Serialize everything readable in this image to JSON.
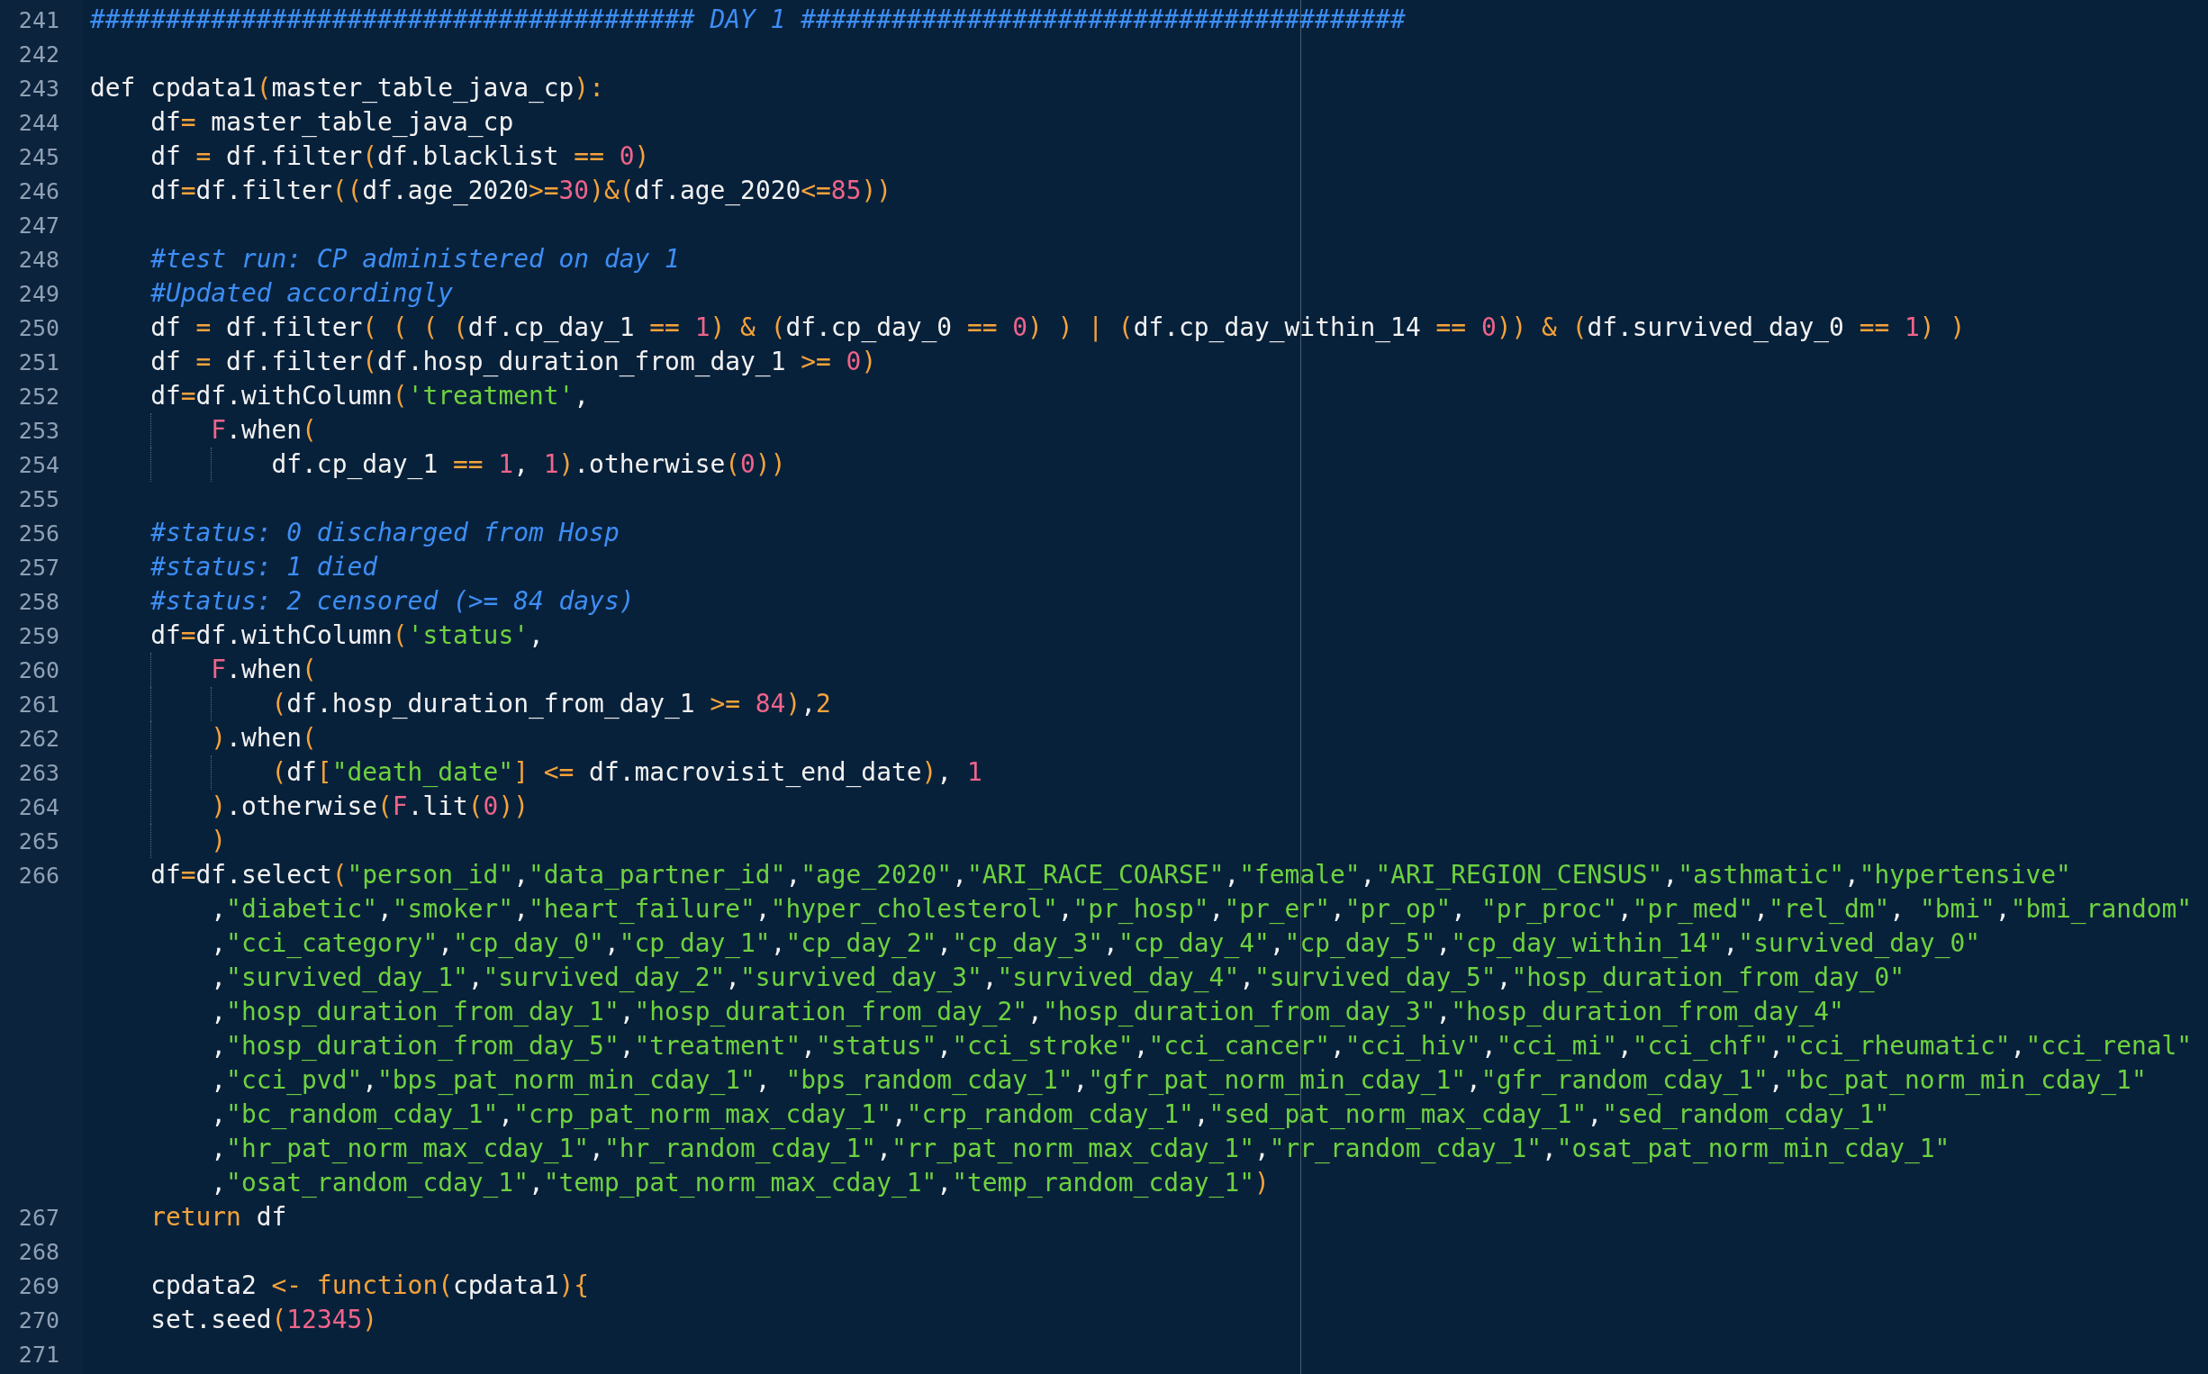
{
  "editor": {
    "lines": [
      {
        "number": "241",
        "rows": [
          {
            "tokens": [
              {
                "kind": "comment",
                "text": "######################################## DAY 1 ########################################"
              }
            ]
          }
        ]
      },
      {
        "number": "242"
      },
      {
        "number": "243",
        "rows": [
          {
            "tokens": [
              {
                "kind": "plain",
                "text": "def cpdata1"
              },
              {
                "kind": "op",
                "text": "("
              },
              {
                "kind": "plain",
                "text": "master_table_java_cp"
              },
              {
                "kind": "op",
                "text": "):"
              }
            ]
          }
        ]
      },
      {
        "number": "244",
        "rows": [
          {
            "tokens": [
              {
                "kind": "indent"
              },
              {
                "kind": "plain",
                "text": "df"
              },
              {
                "kind": "op",
                "text": "="
              },
              {
                "kind": "plain",
                "text": " master_table_java_cp"
              }
            ]
          }
        ]
      },
      {
        "number": "245",
        "rows": [
          {
            "tokens": [
              {
                "kind": "indent"
              },
              {
                "kind": "plain",
                "text": "df "
              },
              {
                "kind": "op",
                "text": "="
              },
              {
                "kind": "plain",
                "text": " df.filter"
              },
              {
                "kind": "op",
                "text": "("
              },
              {
                "kind": "plain",
                "text": "df.blacklist "
              },
              {
                "kind": "op",
                "text": "== "
              },
              {
                "kind": "num",
                "text": "0"
              },
              {
                "kind": "op",
                "text": ")"
              }
            ]
          }
        ]
      },
      {
        "number": "246",
        "rows": [
          {
            "tokens": [
              {
                "kind": "indent"
              },
              {
                "kind": "plain",
                "text": "df"
              },
              {
                "kind": "op",
                "text": "="
              },
              {
                "kind": "plain",
                "text": "df.filter"
              },
              {
                "kind": "op",
                "text": "(("
              },
              {
                "kind": "plain",
                "text": "df.age_2020"
              },
              {
                "kind": "op",
                "text": ">="
              },
              {
                "kind": "num",
                "text": "30"
              },
              {
                "kind": "op",
                "text": ")&("
              },
              {
                "kind": "plain",
                "text": "df.age_2020"
              },
              {
                "kind": "op",
                "text": "<="
              },
              {
                "kind": "num",
                "text": "85"
              },
              {
                "kind": "op",
                "text": "))"
              }
            ]
          }
        ]
      },
      {
        "number": "247"
      },
      {
        "number": "248",
        "rows": [
          {
            "tokens": [
              {
                "kind": "indent"
              },
              {
                "kind": "comment",
                "text": "#test run: CP administered on day 1"
              }
            ]
          }
        ]
      },
      {
        "number": "249",
        "rows": [
          {
            "tokens": [
              {
                "kind": "indent"
              },
              {
                "kind": "comment",
                "text": "#Updated accordingly"
              }
            ]
          }
        ]
      },
      {
        "number": "250",
        "rows": [
          {
            "tokens": [
              {
                "kind": "indent"
              },
              {
                "kind": "plain",
                "text": "df "
              },
              {
                "kind": "op",
                "text": "="
              },
              {
                "kind": "plain",
                "text": " df.filter"
              },
              {
                "kind": "op",
                "text": "( ( ( ("
              },
              {
                "kind": "plain",
                "text": "df.cp_day_1 "
              },
              {
                "kind": "op",
                "text": "== "
              },
              {
                "kind": "num",
                "text": "1"
              },
              {
                "kind": "op",
                "text": ") & ("
              },
              {
                "kind": "plain",
                "text": "df.cp_day_0 "
              },
              {
                "kind": "op",
                "text": "== "
              },
              {
                "kind": "num",
                "text": "0"
              },
              {
                "kind": "op",
                "text": ") ) | ("
              },
              {
                "kind": "plain",
                "text": "df.cp_day_within_14 "
              },
              {
                "kind": "op",
                "text": "== "
              },
              {
                "kind": "num",
                "text": "0"
              },
              {
                "kind": "op",
                "text": ")) & ("
              },
              {
                "kind": "plain",
                "text": "df.survived_day_0 "
              },
              {
                "kind": "op",
                "text": "== "
              },
              {
                "kind": "num",
                "text": "1"
              },
              {
                "kind": "op",
                "text": ") )"
              }
            ]
          }
        ]
      },
      {
        "number": "251",
        "rows": [
          {
            "tokens": [
              {
                "kind": "indent"
              },
              {
                "kind": "plain",
                "text": "df "
              },
              {
                "kind": "op",
                "text": "="
              },
              {
                "kind": "plain",
                "text": " df.filter"
              },
              {
                "kind": "op",
                "text": "("
              },
              {
                "kind": "plain",
                "text": "df.hosp_duration_from_day_1 "
              },
              {
                "kind": "op",
                "text": ">= "
              },
              {
                "kind": "num",
                "text": "0"
              },
              {
                "kind": "op",
                "text": ")"
              }
            ]
          }
        ]
      },
      {
        "number": "252",
        "rows": [
          {
            "tokens": [
              {
                "kind": "indent"
              },
              {
                "kind": "plain",
                "text": "df"
              },
              {
                "kind": "op",
                "text": "="
              },
              {
                "kind": "plain",
                "text": "df.withColumn"
              },
              {
                "kind": "op",
                "text": "("
              },
              {
                "kind": "str",
                "text": "'treatment'"
              },
              {
                "kind": "plain",
                "text": ","
              }
            ]
          }
        ]
      },
      {
        "number": "253",
        "rows": [
          {
            "tokens": [
              {
                "kind": "indent"
              },
              {
                "kind": "guide"
              },
              {
                "kind": "builtin",
                "text": "F"
              },
              {
                "kind": "plain",
                "text": ".when"
              },
              {
                "kind": "op",
                "text": "("
              }
            ]
          }
        ]
      },
      {
        "number": "254",
        "rows": [
          {
            "tokens": [
              {
                "kind": "indent"
              },
              {
                "kind": "guide"
              },
              {
                "kind": "guide"
              },
              {
                "kind": "plain",
                "text": "df.cp_day_1 "
              },
              {
                "kind": "op",
                "text": "== "
              },
              {
                "kind": "num",
                "text": "1"
              },
              {
                "kind": "plain",
                "text": ", "
              },
              {
                "kind": "num",
                "text": "1"
              },
              {
                "kind": "op",
                "text": ")"
              },
              {
                "kind": "plain",
                "text": ".otherwise"
              },
              {
                "kind": "op",
                "text": "("
              },
              {
                "kind": "num",
                "text": "0"
              },
              {
                "kind": "op",
                "text": "))"
              }
            ]
          }
        ]
      },
      {
        "number": "255"
      },
      {
        "number": "256",
        "rows": [
          {
            "tokens": [
              {
                "kind": "indent"
              },
              {
                "kind": "comment",
                "text": "#status: 0 discharged from Hosp"
              }
            ]
          }
        ]
      },
      {
        "number": "257",
        "rows": [
          {
            "tokens": [
              {
                "kind": "indent"
              },
              {
                "kind": "comment",
                "text": "#status: 1 died"
              }
            ]
          }
        ]
      },
      {
        "number": "258",
        "rows": [
          {
            "tokens": [
              {
                "kind": "indent"
              },
              {
                "kind": "comment",
                "text": "#status: 2 censored (>= 84 days)"
              }
            ]
          }
        ]
      },
      {
        "number": "259",
        "rows": [
          {
            "tokens": [
              {
                "kind": "indent"
              },
              {
                "kind": "plain",
                "text": "df"
              },
              {
                "kind": "op",
                "text": "="
              },
              {
                "kind": "plain",
                "text": "df.withColumn"
              },
              {
                "kind": "op",
                "text": "("
              },
              {
                "kind": "str",
                "text": "'status'"
              },
              {
                "kind": "plain",
                "text": ","
              }
            ]
          }
        ]
      },
      {
        "number": "260",
        "rows": [
          {
            "tokens": [
              {
                "kind": "indent"
              },
              {
                "kind": "guide"
              },
              {
                "kind": "builtin",
                "text": "F"
              },
              {
                "kind": "plain",
                "text": ".when"
              },
              {
                "kind": "op",
                "text": "("
              }
            ]
          }
        ]
      },
      {
        "number": "261",
        "rows": [
          {
            "tokens": [
              {
                "kind": "indent"
              },
              {
                "kind": "guide"
              },
              {
                "kind": "guide"
              },
              {
                "kind": "op",
                "text": "("
              },
              {
                "kind": "plain",
                "text": "df.hosp_duration_from_day_1 "
              },
              {
                "kind": "op",
                "text": ">= "
              },
              {
                "kind": "num",
                "text": "84"
              },
              {
                "kind": "op",
                "text": ")"
              },
              {
                "kind": "plain",
                "text": ","
              },
              {
                "kind": "op",
                "text": "2"
              }
            ]
          }
        ]
      },
      {
        "number": "262",
        "rows": [
          {
            "tokens": [
              {
                "kind": "indent"
              },
              {
                "kind": "guide"
              },
              {
                "kind": "op",
                "text": ")"
              },
              {
                "kind": "plain",
                "text": ".when"
              },
              {
                "kind": "op",
                "text": "("
              }
            ]
          }
        ]
      },
      {
        "number": "263",
        "rows": [
          {
            "tokens": [
              {
                "kind": "indent"
              },
              {
                "kind": "guide"
              },
              {
                "kind": "guide"
              },
              {
                "kind": "op",
                "text": "("
              },
              {
                "kind": "plain",
                "text": "df"
              },
              {
                "kind": "op",
                "text": "["
              },
              {
                "kind": "str",
                "text": "\"death_date\""
              },
              {
                "kind": "op",
                "text": "] <="
              },
              {
                "kind": "plain",
                "text": " df.macrovisit_end_date"
              },
              {
                "kind": "op",
                "text": ")"
              },
              {
                "kind": "plain",
                "text": ", "
              },
              {
                "kind": "num",
                "text": "1"
              }
            ]
          }
        ]
      },
      {
        "number": "264",
        "rows": [
          {
            "tokens": [
              {
                "kind": "indent"
              },
              {
                "kind": "guide"
              },
              {
                "kind": "op",
                "text": ")"
              },
              {
                "kind": "plain",
                "text": ".otherwise"
              },
              {
                "kind": "op",
                "text": "("
              },
              {
                "kind": "builtin",
                "text": "F"
              },
              {
                "kind": "plain",
                "text": ".lit"
              },
              {
                "kind": "op",
                "text": "("
              },
              {
                "kind": "num",
                "text": "0"
              },
              {
                "kind": "op",
                "text": "))"
              }
            ]
          }
        ]
      },
      {
        "number": "265",
        "rows": [
          {
            "tokens": [
              {
                "kind": "indent"
              },
              {
                "kind": "guide"
              },
              {
                "kind": "op",
                "text": ")"
              }
            ]
          }
        ]
      },
      {
        "number": "266",
        "rows": [
          {
            "tokens": [
              {
                "kind": "indent"
              },
              {
                "kind": "plain",
                "text": "df"
              },
              {
                "kind": "op",
                "text": "="
              },
              {
                "kind": "plain",
                "text": "df.select"
              },
              {
                "kind": "op",
                "text": "("
              },
              {
                "kind": "str",
                "text": "\"person_id\""
              },
              {
                "kind": "str",
                "lead": ",",
                "text": "\"data_partner_id\""
              },
              {
                "kind": "str",
                "lead": ",",
                "text": "\"age_2020\""
              },
              {
                "kind": "str",
                "lead": ",",
                "text": "\"ARI_RACE_COARSE\""
              },
              {
                "kind": "str",
                "lead": ",",
                "text": "\"female\""
              },
              {
                "kind": "str",
                "lead": ",",
                "text": "\"ARI_REGION_CENSUS\""
              },
              {
                "kind": "str",
                "lead": ",",
                "text": "\"asthmatic\""
              },
              {
                "kind": "str",
                "lead": ",",
                "text": "\"hypertensive\""
              }
            ]
          },
          {
            "tokens": [
              {
                "kind": "indent"
              },
              {
                "kind": "indent"
              },
              {
                "kind": "str",
                "lead": ",",
                "text": "\"diabetic\""
              },
              {
                "kind": "str",
                "lead": ",",
                "text": "\"smoker\""
              },
              {
                "kind": "str",
                "lead": ",",
                "text": "\"heart_failure\""
              },
              {
                "kind": "str",
                "lead": ",",
                "text": "\"hyper_cholesterol\""
              },
              {
                "kind": "str",
                "lead": ",",
                "text": "\"pr_hosp\""
              },
              {
                "kind": "str",
                "lead": ",",
                "text": "\"pr_er\""
              },
              {
                "kind": "str",
                "lead": ",",
                "text": "\"pr_op\""
              },
              {
                "kind": "str",
                "lead": ", ",
                "text": "\"pr_proc\""
              },
              {
                "kind": "str",
                "lead": ",",
                "text": "\"pr_med\""
              },
              {
                "kind": "str",
                "lead": ",",
                "text": "\"rel_dm\""
              },
              {
                "kind": "str",
                "lead": ", ",
                "text": "\"bmi\""
              },
              {
                "kind": "str",
                "lead": ",",
                "text": "\"bmi_random\""
              }
            ]
          },
          {
            "tokens": [
              {
                "kind": "indent"
              },
              {
                "kind": "indent"
              },
              {
                "kind": "str",
                "lead": ",",
                "text": "\"cci_category\""
              },
              {
                "kind": "str",
                "lead": ",",
                "text": "\"cp_day_0\""
              },
              {
                "kind": "str",
                "lead": ",",
                "text": "\"cp_day_1\""
              },
              {
                "kind": "str",
                "lead": ",",
                "text": "\"cp_day_2\""
              },
              {
                "kind": "str",
                "lead": ",",
                "text": "\"cp_day_3\""
              },
              {
                "kind": "str",
                "lead": ",",
                "text": "\"cp_day_4\""
              },
              {
                "kind": "str",
                "lead": ",",
                "text": "\"cp_day_5\""
              },
              {
                "kind": "str",
                "lead": ",",
                "text": "\"cp_day_within_14\""
              },
              {
                "kind": "str",
                "lead": ",",
                "text": "\"survived_day_0\""
              }
            ]
          },
          {
            "tokens": [
              {
                "kind": "indent"
              },
              {
                "kind": "indent"
              },
              {
                "kind": "str",
                "lead": ",",
                "text": "\"survived_day_1\""
              },
              {
                "kind": "str",
                "lead": ",",
                "text": "\"survived_day_2\""
              },
              {
                "kind": "str",
                "lead": ",",
                "text": "\"survived_day_3\""
              },
              {
                "kind": "str",
                "lead": ",",
                "text": "\"survived_day_4\""
              },
              {
                "kind": "str",
                "lead": ",",
                "text": "\"survived_day_5\""
              },
              {
                "kind": "str",
                "lead": ",",
                "text": "\"hosp_duration_from_day_0\""
              }
            ]
          },
          {
            "tokens": [
              {
                "kind": "indent"
              },
              {
                "kind": "indent"
              },
              {
                "kind": "str",
                "lead": ",",
                "text": "\"hosp_duration_from_day_1\""
              },
              {
                "kind": "str",
                "lead": ",",
                "text": "\"hosp_duration_from_day_2\""
              },
              {
                "kind": "str",
                "lead": ",",
                "text": "\"hosp_duration_from_day_3\""
              },
              {
                "kind": "str",
                "lead": ",",
                "text": "\"hosp_duration_from_day_4\""
              }
            ]
          },
          {
            "tokens": [
              {
                "kind": "indent"
              },
              {
                "kind": "indent"
              },
              {
                "kind": "str",
                "lead": ",",
                "text": "\"hosp_duration_from_day_5\""
              },
              {
                "kind": "str",
                "lead": ",",
                "text": "\"treatment\""
              },
              {
                "kind": "str",
                "lead": ",",
                "text": "\"status\""
              },
              {
                "kind": "str",
                "lead": ",",
                "text": "\"cci_stroke\""
              },
              {
                "kind": "str",
                "lead": ",",
                "text": "\"cci_cancer\""
              },
              {
                "kind": "str",
                "lead": ",",
                "text": "\"cci_hiv\""
              },
              {
                "kind": "str",
                "lead": ",",
                "text": "\"cci_mi\""
              },
              {
                "kind": "str",
                "lead": ",",
                "text": "\"cci_chf\""
              },
              {
                "kind": "str",
                "lead": ",",
                "text": "\"cci_rheumatic\""
              },
              {
                "kind": "str",
                "lead": ",",
                "text": "\"cci_renal\""
              }
            ]
          },
          {
            "tokens": [
              {
                "kind": "indent"
              },
              {
                "kind": "indent"
              },
              {
                "kind": "str",
                "lead": ",",
                "text": "\"cci_pvd\""
              },
              {
                "kind": "str",
                "lead": ",",
                "text": "\"bps_pat_norm_min_cday_1\""
              },
              {
                "kind": "str",
                "lead": ", ",
                "text": "\"bps_random_cday_1\""
              },
              {
                "kind": "str",
                "lead": ",",
                "text": "\"gfr_pat_norm_min_cday_1\""
              },
              {
                "kind": "str",
                "lead": ",",
                "text": "\"gfr_random_cday_1\""
              },
              {
                "kind": "str",
                "lead": ",",
                "text": "\"bc_pat_norm_min_cday_1\""
              }
            ]
          },
          {
            "tokens": [
              {
                "kind": "indent"
              },
              {
                "kind": "indent"
              },
              {
                "kind": "str",
                "lead": ",",
                "text": "\"bc_random_cday_1\""
              },
              {
                "kind": "str",
                "lead": ",",
                "text": "\"crp_pat_norm_max_cday_1\""
              },
              {
                "kind": "str",
                "lead": ",",
                "text": "\"crp_random_cday_1\""
              },
              {
                "kind": "str",
                "lead": ",",
                "text": "\"sed_pat_norm_max_cday_1\""
              },
              {
                "kind": "str",
                "lead": ",",
                "text": "\"sed_random_cday_1\""
              }
            ]
          },
          {
            "tokens": [
              {
                "kind": "indent"
              },
              {
                "kind": "indent"
              },
              {
                "kind": "str",
                "lead": ",",
                "text": "\"hr_pat_norm_max_cday_1\""
              },
              {
                "kind": "str",
                "lead": ",",
                "text": "\"hr_random_cday_1\""
              },
              {
                "kind": "str",
                "lead": ",",
                "text": "\"rr_pat_norm_max_cday_1\""
              },
              {
                "kind": "str",
                "lead": ",",
                "text": "\"rr_random_cday_1\""
              },
              {
                "kind": "str",
                "lead": ",",
                "text": "\"osat_pat_norm_min_cday_1\""
              }
            ]
          },
          {
            "tokens": [
              {
                "kind": "indent"
              },
              {
                "kind": "indent"
              },
              {
                "kind": "str",
                "lead": ",",
                "text": "\"osat_random_cday_1\""
              },
              {
                "kind": "str",
                "lead": ",",
                "text": "\"temp_pat_norm_max_cday_1\""
              },
              {
                "kind": "str",
                "lead": ",",
                "text": "\"temp_random_cday_1\""
              },
              {
                "kind": "op",
                "text": ")"
              }
            ]
          }
        ]
      },
      {
        "number": "267",
        "rows": [
          {
            "tokens": [
              {
                "kind": "indent"
              },
              {
                "kind": "op",
                "text": "return"
              },
              {
                "kind": "plain",
                "text": " df"
              }
            ]
          }
        ]
      },
      {
        "number": "268"
      },
      {
        "number": "269",
        "rows": [
          {
            "tokens": [
              {
                "kind": "indent"
              },
              {
                "kind": "plain",
                "text": "cpdata2 "
              },
              {
                "kind": "op",
                "text": "<- function("
              },
              {
                "kind": "plain",
                "text": "cpdata1"
              },
              {
                "kind": "op",
                "text": "){"
              }
            ]
          }
        ]
      },
      {
        "number": "270",
        "rows": [
          {
            "tokens": [
              {
                "kind": "indent"
              },
              {
                "kind": "plain",
                "text": "set.seed"
              },
              {
                "kind": "op",
                "text": "("
              },
              {
                "kind": "num",
                "text": "12345"
              },
              {
                "kind": "op",
                "text": ")"
              }
            ]
          }
        ]
      },
      {
        "number": "271"
      }
    ]
  }
}
